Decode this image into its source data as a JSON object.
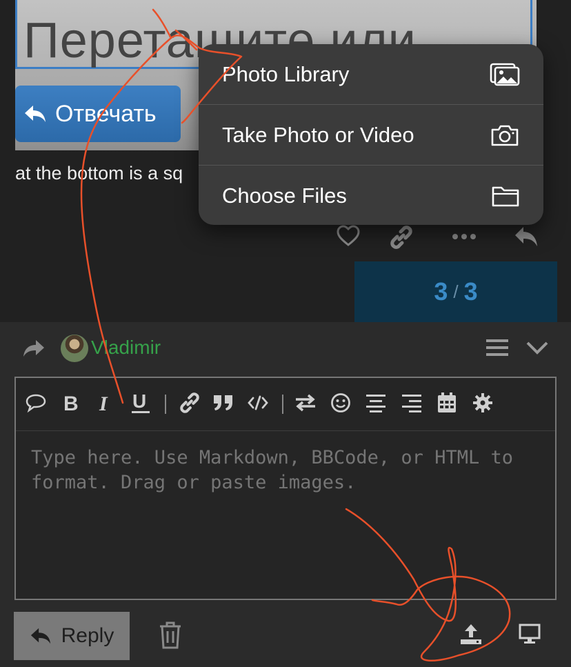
{
  "post": {
    "embedded_image": {
      "big_text": "Перетащите или",
      "button_label": "Отвечать"
    },
    "text": "at the bottom is a sq"
  },
  "post_actions": {
    "like_icon": "heart-icon",
    "link_icon": "link-icon",
    "more_icon": "ellipsis-icon",
    "reply_icon": "reply-icon"
  },
  "progress": {
    "current": "3",
    "separator": "/",
    "total": "3"
  },
  "popup_menu": {
    "items": [
      {
        "label": "Photo Library",
        "icon": "photo-library-icon"
      },
      {
        "label": "Take Photo or Video",
        "icon": "camera-icon"
      },
      {
        "label": "Choose Files",
        "icon": "folder-icon"
      }
    ]
  },
  "composer": {
    "user_name": "Vladimir",
    "textarea_placeholder": "Type here. Use Markdown, BBCode, or HTML to format. Drag or paste images.",
    "reply_label": "Reply",
    "toolbar": [
      "quote-icon",
      "bold-icon",
      "italic-icon",
      "underline-icon",
      "link-icon",
      "blockquote-icon",
      "code-icon",
      "swap-icon",
      "emoji-icon",
      "align-center-icon",
      "align-right-icon",
      "calendar-icon",
      "gear-icon"
    ]
  },
  "colors": {
    "background": "#212121",
    "composer": "#2b2b2b",
    "popup": "#3b3b3b",
    "user_name": "#36a24a",
    "progress_bg": "#0d3349",
    "progress_text": "#3a8bc7",
    "annotation": "#e8502a"
  }
}
